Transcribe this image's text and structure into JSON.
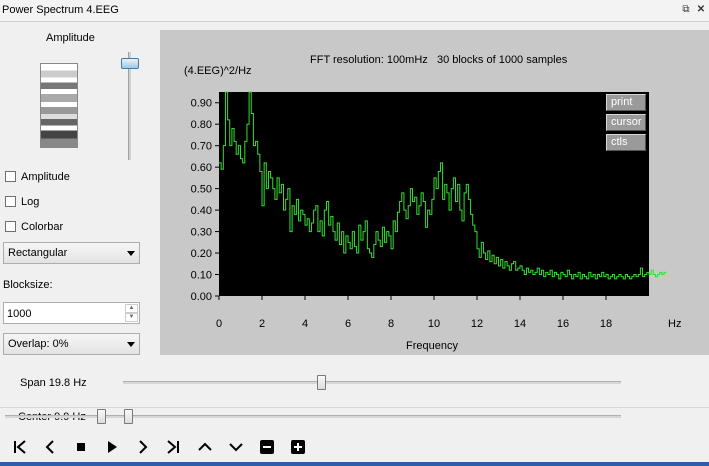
{
  "window": {
    "title": "Power Spectrum 4.EEG",
    "restore_icon": "restore-icon",
    "close_icon": "close-icon"
  },
  "left": {
    "amplitude_label": "Amplitude",
    "amplitude_checkbox": "Amplitude",
    "log_checkbox": "Log",
    "colorbar_checkbox": "Colorbar",
    "window_select": "Rectangular",
    "blocksize_label": "Blocksize:",
    "blocksize_value": "1000",
    "overlap_select": "Overlap: 0%"
  },
  "plot": {
    "info": "FFT resolution: 100mHz   30 blocks of 1000 samples",
    "print_btn": "print",
    "cursor_btn": "cursor",
    "ctls_btn": "ctls"
  },
  "chart_data": {
    "type": "line",
    "title": "",
    "ylabel": "(4.EEG)^2/Hz",
    "xlabel": "Frequency",
    "xunit": "Hz",
    "xlim": [
      0,
      20
    ],
    "ylim": [
      0,
      0.95
    ],
    "xticks": [
      "0",
      "2",
      "4",
      "6",
      "8",
      "10",
      "12",
      "14",
      "16",
      "18"
    ],
    "yticks": [
      "0.00",
      "0.10",
      "0.20",
      "0.30",
      "0.40",
      "0.50",
      "0.60",
      "0.70",
      "0.80",
      "0.90"
    ],
    "grid": false,
    "color": "#33dd33",
    "background": "#000000",
    "series": [
      {
        "step": 0.1,
        "values": [
          0.62,
          0.59,
          0.7,
          1.0,
          0.82,
          0.7,
          0.78,
          0.72,
          0.66,
          0.7,
          0.64,
          0.62,
          0.72,
          0.8,
          1.0,
          0.85,
          0.7,
          0.72,
          0.66,
          0.58,
          0.42,
          0.62,
          0.5,
          0.58,
          0.55,
          0.5,
          0.45,
          0.55,
          0.48,
          0.52,
          0.4,
          0.45,
          0.5,
          0.3,
          0.42,
          0.38,
          0.45,
          0.35,
          0.4,
          0.38,
          0.33,
          0.36,
          0.3,
          0.34,
          0.4,
          0.42,
          0.3,
          0.35,
          0.28,
          0.4,
          0.44,
          0.33,
          0.37,
          0.3,
          0.26,
          0.34,
          0.24,
          0.3,
          0.2,
          0.28,
          0.25,
          0.22,
          0.3,
          0.23,
          0.2,
          0.33,
          0.26,
          0.3,
          0.35,
          0.22,
          0.2,
          0.18,
          0.24,
          0.3,
          0.26,
          0.23,
          0.32,
          0.25,
          0.3,
          0.28,
          0.22,
          0.35,
          0.3,
          0.39,
          0.44,
          0.48,
          0.4,
          0.36,
          0.42,
          0.5,
          0.44,
          0.46,
          0.38,
          0.42,
          0.48,
          0.44,
          0.32,
          0.4,
          0.38,
          0.45,
          0.55,
          0.5,
          0.58,
          0.62,
          0.45,
          0.52,
          0.48,
          0.4,
          0.5,
          0.55,
          0.44,
          0.52,
          0.4,
          0.35,
          0.48,
          0.52,
          0.45,
          0.38,
          0.33,
          0.3,
          0.22,
          0.18,
          0.25,
          0.2,
          0.17,
          0.21,
          0.16,
          0.19,
          0.15,
          0.18,
          0.14,
          0.17,
          0.13,
          0.16,
          0.14,
          0.12,
          0.15,
          0.16,
          0.12,
          0.13,
          0.14,
          0.12,
          0.1,
          0.13,
          0.11,
          0.12,
          0.1,
          0.11,
          0.13,
          0.1,
          0.12,
          0.09,
          0.11,
          0.1,
          0.12,
          0.09,
          0.11,
          0.1,
          0.08,
          0.11,
          0.1,
          0.09,
          0.12,
          0.1,
          0.08,
          0.1,
          0.09,
          0.11,
          0.08,
          0.1,
          0.09,
          0.08,
          0.11,
          0.09,
          0.1,
          0.08,
          0.1,
          0.09,
          0.11,
          0.09,
          0.1,
          0.08,
          0.09,
          0.1,
          0.08,
          0.09,
          0.1,
          0.09,
          0.08,
          0.1,
          0.09,
          0.08,
          0.09,
          0.1,
          0.09,
          0.1,
          0.13,
          0.09,
          0.1,
          0.11,
          0.1,
          0.12,
          0.1,
          0.09,
          0.1,
          0.11,
          0.1,
          0.11
        ]
      }
    ]
  },
  "bottom": {
    "span_label": "Span 19.8 Hz",
    "span_value": 0.5,
    "center_label": "Center 9.9 Hz",
    "center_value": 0.0
  },
  "toolbar": [
    "first-icon",
    "prev-icon",
    "stop-icon",
    "play-icon",
    "next-icon",
    "last-icon",
    "up-icon",
    "down-icon",
    "zoom-out-icon",
    "zoom-in-icon"
  ]
}
